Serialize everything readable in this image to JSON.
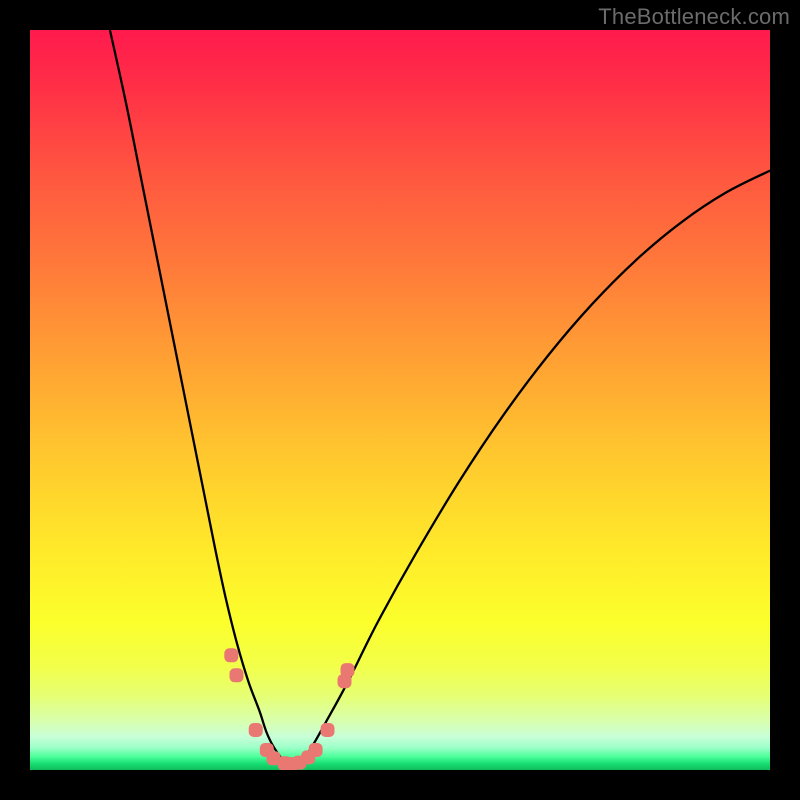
{
  "watermark": "TheBottleneck.com",
  "colors": {
    "background": "#000000",
    "gradient_top": "#ff1a4d",
    "gradient_bottom": "#0fbc5a",
    "curve": "#000000",
    "marker": "#e97772"
  },
  "chart_data": {
    "type": "line",
    "title": "",
    "xlabel": "",
    "ylabel": "",
    "xlim": [
      0,
      100
    ],
    "ylim": [
      0,
      100
    ],
    "grid": false,
    "legend": false,
    "note": "No axis ticks or numeric labels are visible; values are estimated pixel-normalized positions of the plotted curve within the inner plot area (0,0 = top-left, 100,100 = bottom-right).",
    "series": [
      {
        "name": "bottleneck-curve",
        "x": [
          10.8,
          13,
          15,
          17,
          19,
          21,
          23,
          25,
          26.5,
          28,
          29.5,
          31,
          32,
          33,
          34.5,
          35.3,
          36.5,
          38,
          40,
          43,
          47,
          52,
          58,
          64,
          70,
          76,
          82,
          88,
          94,
          100
        ],
        "y": [
          0,
          10,
          20,
          30,
          40,
          50,
          60,
          70,
          77,
          83,
          88,
          92,
          95,
          97,
          99,
          99.3,
          99,
          97,
          93.5,
          88,
          80,
          71,
          61,
          52,
          44,
          37,
          31,
          26,
          22,
          19
        ]
      }
    ],
    "markers": {
      "name": "highlight-points",
      "shape": "rounded-square",
      "color": "#e97772",
      "points_xy": [
        [
          27.2,
          84.5
        ],
        [
          27.9,
          87.2
        ],
        [
          30.5,
          94.6
        ],
        [
          32.0,
          97.3
        ],
        [
          32.9,
          98.4
        ],
        [
          34.4,
          99.1
        ],
        [
          35.3,
          99.2
        ],
        [
          36.4,
          99.0
        ],
        [
          37.6,
          98.3
        ],
        [
          38.6,
          97.3
        ],
        [
          40.2,
          94.6
        ],
        [
          42.5,
          88.0
        ],
        [
          42.9,
          86.5
        ]
      ]
    }
  }
}
